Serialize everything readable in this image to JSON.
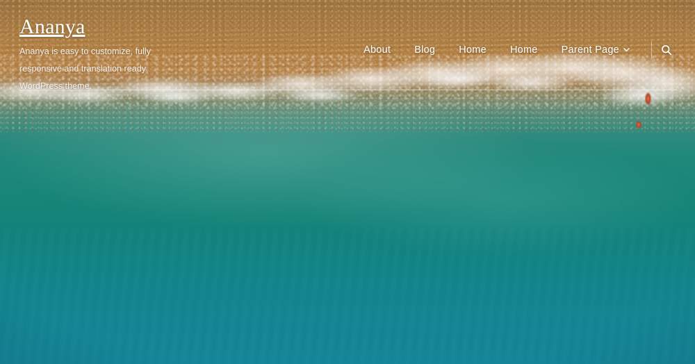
{
  "site": {
    "title": "Ananya",
    "description": "Ananya is easy to customize, fully responsive and translation ready WordPress theme."
  },
  "nav": {
    "items": [
      {
        "label": "About",
        "has_dropdown": false
      },
      {
        "label": "Blog",
        "has_dropdown": false
      },
      {
        "label": "Home",
        "has_dropdown": false
      },
      {
        "label": "Home",
        "has_dropdown": false
      },
      {
        "label": "Parent Page",
        "has_dropdown": true
      }
    ],
    "dropdown_icon": "chevron-down-icon",
    "search_icon": "search-icon"
  },
  "theme": {
    "text_color": "#ffffff",
    "rule_color": "rgba(255,255,255,0.48)",
    "sand_top": "#9d7540",
    "sand_mid": "#b68248",
    "foam": "#ffffff",
    "water_shallow": "#2e8a7e",
    "water_mid": "#15847c",
    "water_deep": "#15879a"
  }
}
